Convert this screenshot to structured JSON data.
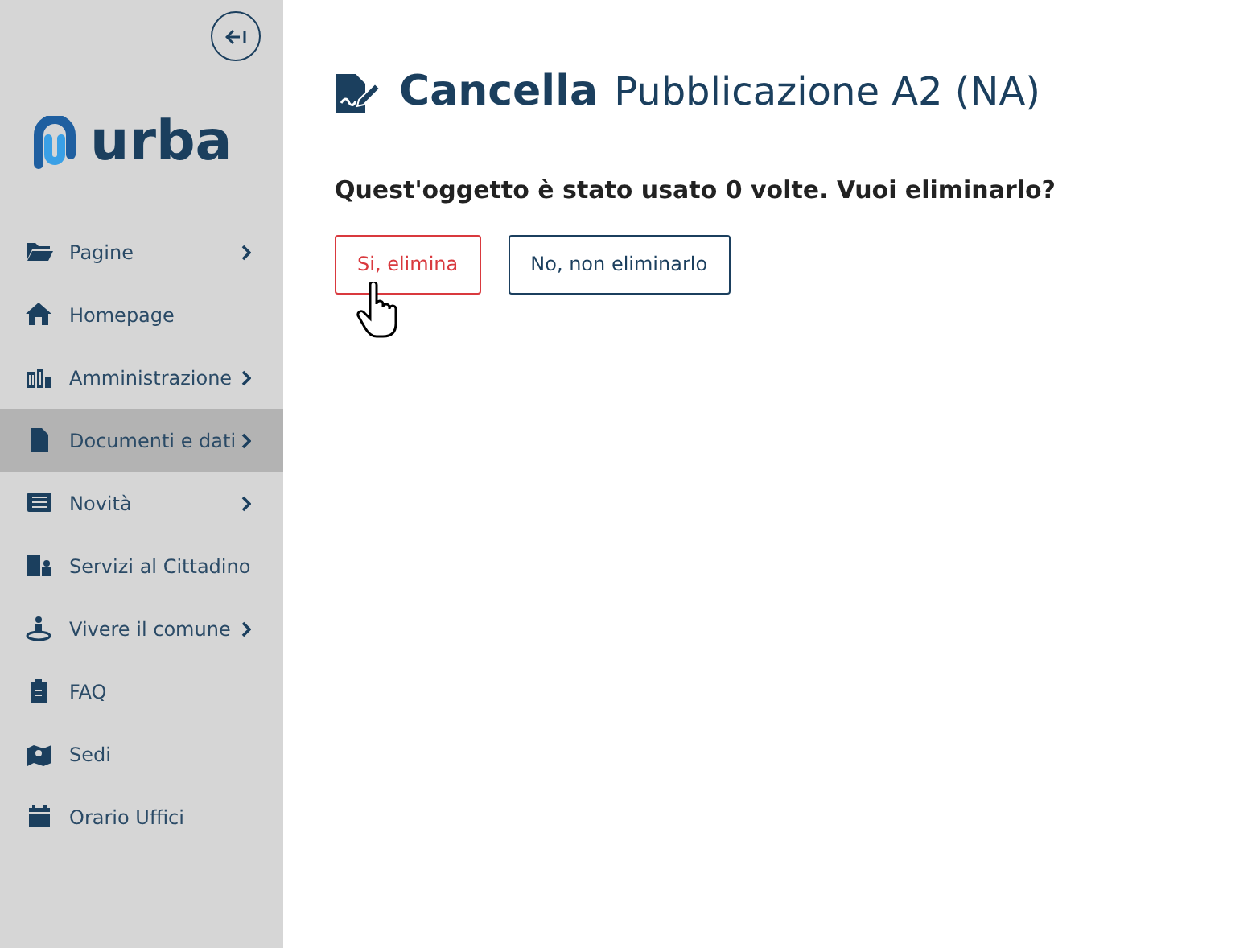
{
  "sidebar": {
    "logo": {
      "text": "urba"
    },
    "items": [
      {
        "label": "Pagine",
        "has_submenu": true,
        "selected": false
      },
      {
        "label": "Homepage",
        "has_submenu": false,
        "selected": false
      },
      {
        "label": "Amministrazione",
        "has_submenu": true,
        "selected": false
      },
      {
        "label": "Documenti e dati",
        "has_submenu": true,
        "selected": true
      },
      {
        "label": "Novità",
        "has_submenu": true,
        "selected": false
      },
      {
        "label": "Servizi al Cittadino",
        "has_submenu": false,
        "selected": false
      },
      {
        "label": "Vivere il comune",
        "has_submenu": true,
        "selected": false
      },
      {
        "label": "FAQ",
        "has_submenu": false,
        "selected": false
      },
      {
        "label": "Sedi",
        "has_submenu": false,
        "selected": false
      },
      {
        "label": "Orario Uffici",
        "has_submenu": false,
        "selected": false
      }
    ]
  },
  "header": {
    "action": "Cancella",
    "title": "Pubblicazione A2 (NA)"
  },
  "question": "Quest'oggetto è stato usato 0 volte. Vuoi eliminarlo?",
  "buttons": [
    {
      "label": "Si, elimina",
      "kind": "danger"
    },
    {
      "label": "No, non eliminarlo",
      "kind": "secondary"
    }
  ]
}
